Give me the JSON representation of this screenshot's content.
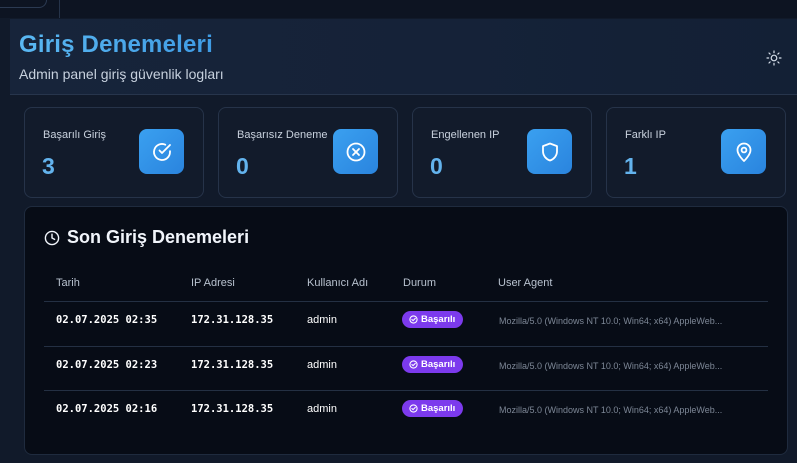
{
  "header": {
    "title": "Giriş Denemeleri",
    "subtitle": "Admin panel giriş güvenlik logları",
    "theme_icon": "sun-icon"
  },
  "stats": [
    {
      "label": "Başarılı Giriş",
      "value": "3",
      "icon": "check-circle-icon"
    },
    {
      "label": "Başarısız Deneme",
      "value": "0",
      "icon": "x-circle-icon"
    },
    {
      "label": "Engellenen IP",
      "value": "0",
      "icon": "shield-icon"
    },
    {
      "label": "Farklı IP",
      "value": "1",
      "icon": "map-pin-icon"
    }
  ],
  "table": {
    "title": "Son Giriş Denemeleri",
    "title_icon": "clock-icon",
    "columns": [
      "Tarih",
      "IP Adresi",
      "Kullanıcı Adı",
      "Durum",
      "User Agent"
    ],
    "rows": [
      {
        "date": "02.07.2025 02:35",
        "ip": "172.31.128.35",
        "user": "admin",
        "status": "Başarılı",
        "agent": "Mozilla/5.0 (Windows NT 10.0; Win64; x64) AppleWeb..."
      },
      {
        "date": "02.07.2025 02:23",
        "ip": "172.31.128.35",
        "user": "admin",
        "status": "Başarılı",
        "agent": "Mozilla/5.0 (Windows NT 10.0; Win64; x64) AppleWeb..."
      },
      {
        "date": "02.07.2025 02:16",
        "ip": "172.31.128.35",
        "user": "admin",
        "status": "Başarılı",
        "agent": "Mozilla/5.0 (Windows NT 10.0; Win64; x64) AppleWeb..."
      }
    ]
  },
  "colors": {
    "accent": "#3b9ae8",
    "badge": "#7c3aed",
    "background": "#111a2a",
    "panel": "#070c16"
  }
}
